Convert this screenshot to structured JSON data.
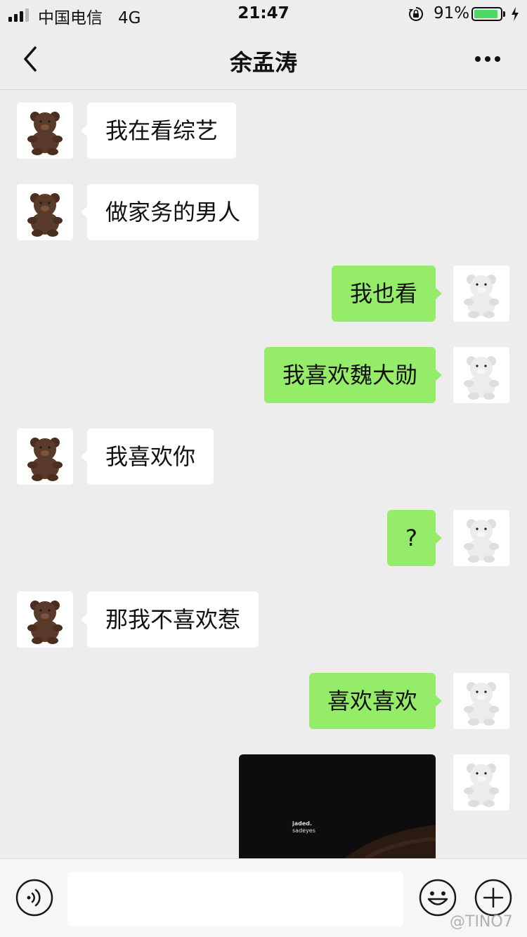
{
  "status_bar": {
    "carrier": "中国电信",
    "network": "4G",
    "time": "21:47",
    "battery_percent": "91%",
    "battery_level": 0.91,
    "battery_color": "#4cd964",
    "icons": [
      "signal-icon",
      "orientation-lock-icon",
      "battery-icon",
      "charging-bolt-icon"
    ]
  },
  "nav": {
    "title": "余孟涛",
    "back_icon": "chevron-left-icon",
    "more_icon": "more-dots-icon"
  },
  "messages": [
    {
      "side": "in",
      "text": "我在看综艺"
    },
    {
      "side": "in",
      "text": "做家务的男人"
    },
    {
      "side": "out",
      "text": "我也看"
    },
    {
      "side": "out",
      "text": "我喜欢魏大勋"
    },
    {
      "side": "in",
      "text": "我喜欢你"
    },
    {
      "side": "out",
      "text": "?"
    },
    {
      "side": "in",
      "text": "那我不喜欢惹"
    },
    {
      "side": "out",
      "text": "喜欢喜欢"
    }
  ],
  "image_message": {
    "side": "out",
    "title": "jaded.",
    "subtitle": "sadeyes"
  },
  "input_bar": {
    "value": "",
    "voice_icon": "voice-icon",
    "emoji_icon": "emoji-icon",
    "plus_icon": "plus-icon"
  },
  "colors": {
    "background": "#ededed",
    "outgoing_bubble": "#95ec69",
    "incoming_bubble": "#ffffff"
  },
  "watermark": "@TINO7"
}
